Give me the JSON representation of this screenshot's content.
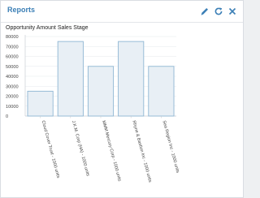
{
  "header": {
    "title": "Reports",
    "accent": "#3b7fb6"
  },
  "toolbar": {
    "icons": [
      "pencil-icon",
      "refresh-icon",
      "close-icon"
    ]
  },
  "chart_data": {
    "type": "bar",
    "title": "Opportunity Amount Sales Stage",
    "xlabel": "",
    "ylabel": "",
    "categories": [
      "Cloud Cover Trust - 1000 units",
      "J.K.M. Corp (HA) - 1000 units",
      "MMM Mercury Corp - 1000 units",
      "Rhyne & Bastion Inc - 1000 units",
      "Sea Region Inc - 1000 units"
    ],
    "values": [
      25000,
      75000,
      50000,
      75000,
      50000
    ],
    "ylim": [
      0,
      80000
    ],
    "yticks": [
      "0",
      "10000",
      "20000",
      "30000",
      "40000",
      "50000",
      "60000",
      "70000",
      "80000"
    ],
    "grid": true,
    "bar_fill": "#e8eff5",
    "bar_stroke": "#8fb6d3"
  }
}
